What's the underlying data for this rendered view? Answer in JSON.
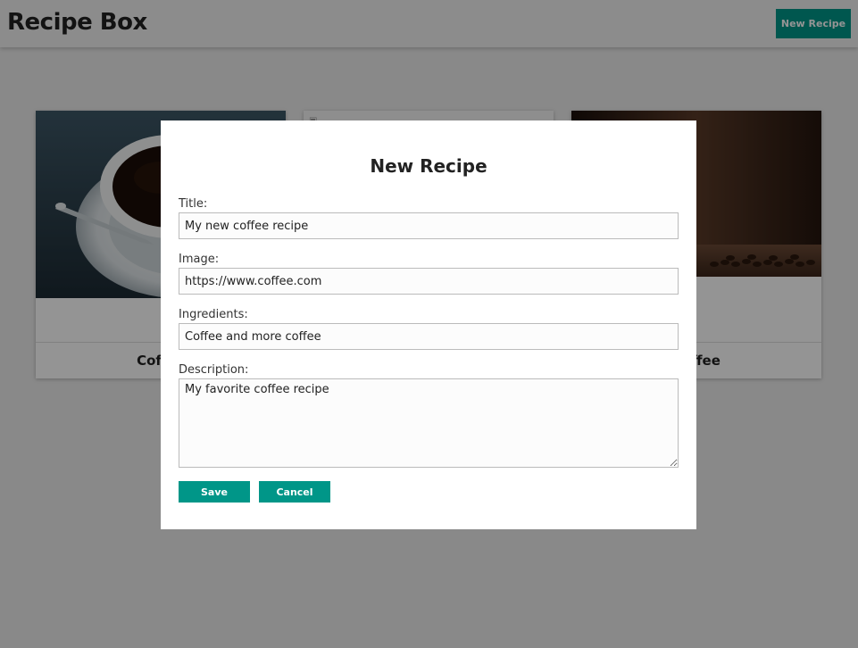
{
  "header": {
    "title": "Recipe Box",
    "new_recipe_label": "New Recipe"
  },
  "cards": [
    {
      "title": "Coffee",
      "image_icon": "coffee-cup-photo"
    },
    {
      "title": "",
      "image_icon": "broken-image-thumbnail"
    },
    {
      "title": "Coffee",
      "image_icon": "coffee-beans-photo"
    }
  ],
  "modal": {
    "title": "New Recipe",
    "fields": {
      "title": {
        "label": "Title:",
        "value": "My new coffee recipe"
      },
      "image": {
        "label": "Image:",
        "value": "https://www.coffee.com"
      },
      "ingredients": {
        "label": "Ingredients:",
        "value": "Coffee and more coffee"
      },
      "description": {
        "label": "Description:",
        "value": "My favorite coffee recipe"
      }
    },
    "save_label": "Save",
    "cancel_label": "Cancel"
  },
  "colors": {
    "accent": "#009688",
    "overlay": "rgba(0,0,0,0.42)"
  }
}
